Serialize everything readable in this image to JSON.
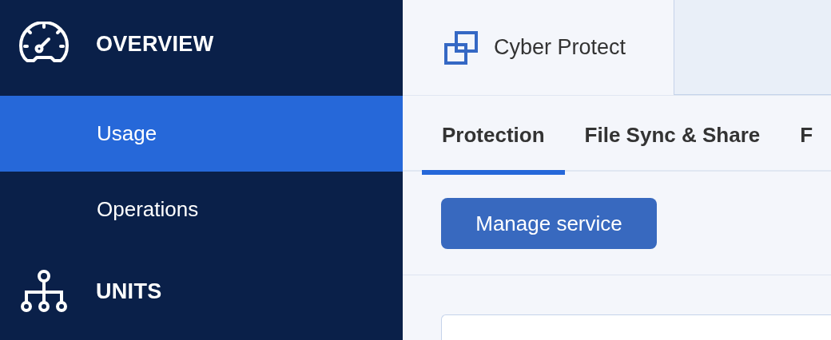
{
  "sidebar": {
    "sections": [
      {
        "label": "OVERVIEW",
        "items": [
          {
            "label": "Usage",
            "selected": true
          },
          {
            "label": "Operations",
            "selected": false
          }
        ]
      },
      {
        "label": "UNITS"
      }
    ]
  },
  "header": {
    "product": "Cyber Protect"
  },
  "tabs": [
    {
      "label": "Protection",
      "selected": true
    },
    {
      "label": "File Sync & Share",
      "selected": false
    },
    {
      "label": "F",
      "selected": false
    }
  ],
  "button": "Manage service"
}
